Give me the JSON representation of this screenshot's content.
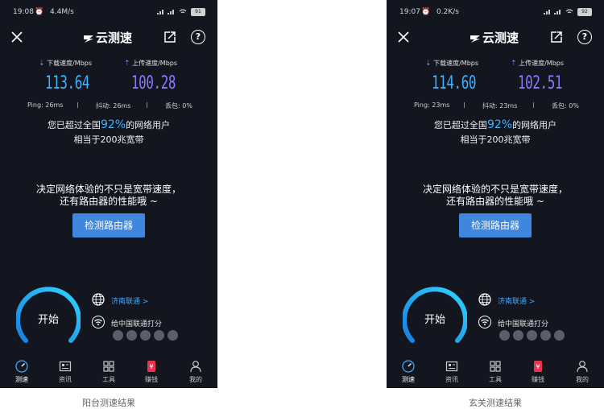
{
  "app_name": "云测速",
  "screens": [
    {
      "status": {
        "time": "19:08",
        "net_speed": "4.4M/s",
        "battery": "91"
      },
      "download": {
        "label": "下载速度/Mbps",
        "value": "113.64"
      },
      "upload": {
        "label": "上传速度/Mbps",
        "value": "100.28"
      },
      "ping": "Ping: 26ms",
      "jitter": "抖动: 26ms",
      "loss": "丢包: 0%",
      "beat_prefix": "您已超过全国",
      "beat_pct": "92%",
      "beat_suffix": "的网络用户",
      "equiv": "相当于200兆宽带",
      "caption": "阳台测速结果"
    },
    {
      "status": {
        "time": "19:07",
        "net_speed": "0.2K/s",
        "battery": "92"
      },
      "download": {
        "label": "下载速度/Mbps",
        "value": "114.60"
      },
      "upload": {
        "label": "上传速度/Mbps",
        "value": "102.51"
      },
      "ping": "Ping: 23ms",
      "jitter": "抖动: 23ms",
      "loss": "丢包: 0%",
      "beat_prefix": "您已超过全国",
      "beat_pct": "92%",
      "beat_suffix": "的网络用户",
      "equiv": "相当于200兆宽带",
      "caption": "玄关测速结果"
    }
  ],
  "promo_line1": "决定网络体验的不只是宽带速度，",
  "promo_line2": "还有路由器的性能哦 ~",
  "detect_button": "检测路由器",
  "start_label": "开始",
  "isp": "济南联通 >",
  "rate_isp": "给中国联通打分",
  "tabs": [
    "测速",
    "资讯",
    "工具",
    "赚钱",
    "我的"
  ],
  "icons": [
    "close-icon",
    "share-icon",
    "help-icon",
    "globe-icon",
    "wifi-icon",
    "speedometer-icon",
    "news-icon",
    "tools-icon",
    "money-icon",
    "profile-icon"
  ],
  "colors": {
    "background": "#13151f",
    "download": "#3bb3ff",
    "upload": "#8b7cff",
    "button": "#3f86dd",
    "gauge": "#22b0f5",
    "money_tab": "#e8344c"
  }
}
